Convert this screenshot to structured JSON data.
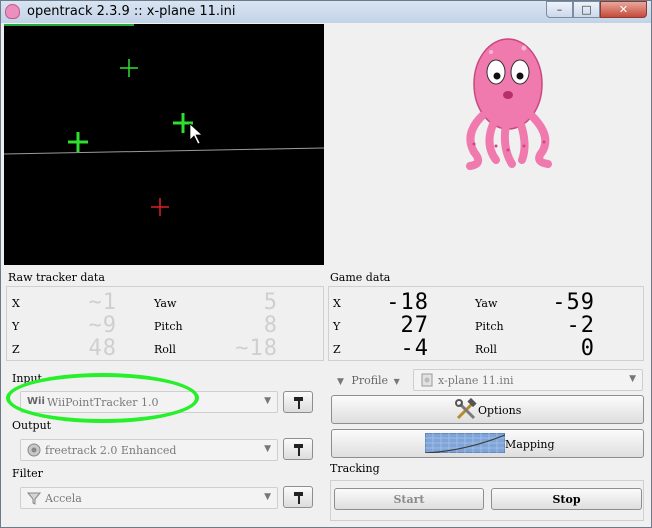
{
  "window": {
    "title": "opentrack 2.3.9 :: x-plane 11.ini",
    "buttons": {
      "minimize": "–",
      "maximize": "□",
      "close": "✕"
    }
  },
  "raw_tracker": {
    "title": "Raw tracker data",
    "rows": [
      {
        "axis_a": "X",
        "value_a": "~1",
        "axis_b": "Yaw",
        "value_b": "5"
      },
      {
        "axis_a": "Y",
        "value_a": "~9",
        "axis_b": "Pitch",
        "value_b": "8"
      },
      {
        "axis_a": "Z",
        "value_a": "48",
        "axis_b": "Roll",
        "value_b": "~18"
      }
    ]
  },
  "game_data": {
    "title": "Game data",
    "rows": [
      {
        "axis_a": "X",
        "value_a": "-18",
        "axis_b": "Yaw",
        "value_b": "-59"
      },
      {
        "axis_a": "Y",
        "value_a": "27",
        "axis_b": "Pitch",
        "value_b": "-2"
      },
      {
        "axis_a": "Z",
        "value_a": "-4",
        "axis_b": "Roll",
        "value_b": "0"
      }
    ]
  },
  "input": {
    "label": "Input",
    "value": "WiiPointTracker 1.0",
    "icon_text": "Wii"
  },
  "output": {
    "label": "Output",
    "value": "freetrack 2.0 Enhanced"
  },
  "filter": {
    "label": "Filter",
    "value": "Accela"
  },
  "profile": {
    "label": "Profile",
    "value": "x-plane 11.ini"
  },
  "options_button": "Options",
  "mapping_button": "Mapping",
  "tracking": {
    "label": "Tracking",
    "start": "Start",
    "stop": "Stop"
  },
  "colors": {
    "video_bg": "#000000",
    "marker_green": "#2ee02e",
    "marker_red": "#e02020",
    "octopus_pink": "#f07aae",
    "highlight_green": "#25f02a"
  },
  "icons": {
    "app": "octopus-icon",
    "settings": "hammer-icon",
    "options": "tools-icon",
    "mapping": "curve-graph-icon",
    "filter": "funnel-icon",
    "output": "freetrack-icon",
    "profile": "document-icon"
  }
}
